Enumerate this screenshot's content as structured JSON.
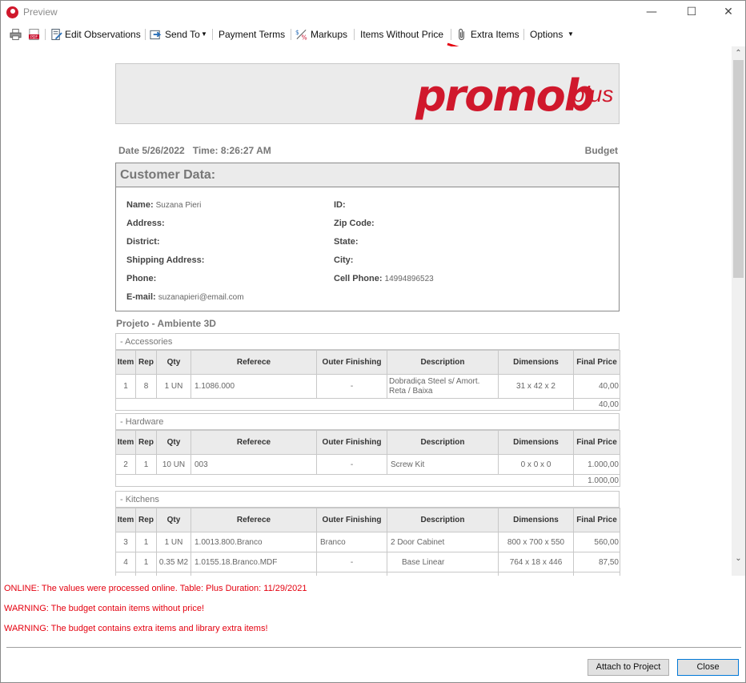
{
  "window": {
    "title": "Preview",
    "minimize": "—",
    "maximize": "☐",
    "close": "✕"
  },
  "toolbar": {
    "print_icon": "printer-icon",
    "pdf_icon": "pdf-icon",
    "edit_observations": "Edit Observations",
    "send_to": "Send To",
    "payment_terms": "Payment Terms",
    "markups": "Markups",
    "items_without_price": "Items Without Price",
    "extra_items": "Extra Items",
    "options": "Options"
  },
  "document": {
    "logo_main": "promob",
    "logo_sub": "plus",
    "date_line": "Date 5/26/2022   Time: 8:26:27 AM",
    "budget": "Budget",
    "customer_title": "Customer Data:",
    "customer": {
      "name_label": "Name:",
      "name_value": "Suzana Pieri",
      "id_label": "ID:",
      "address_label": "Address:",
      "zip_label": "Zip Code:",
      "district_label": "District:",
      "state_label": "State:",
      "shipping_label": "Shipping Address:",
      "city_label": "City:",
      "phone_label": "Phone:",
      "cell_label": "Cell Phone:",
      "cell_value": "14994896523",
      "email_label": "E-mail:",
      "email_value": "suzanapieri@email.com"
    },
    "project_title": "Projeto - Ambiente 3D",
    "columns": [
      "Item",
      "Rep",
      "Qty",
      "Referece",
      "Outer Finishing",
      "Description",
      "Dimensions",
      "Final Price"
    ],
    "sections": [
      {
        "title": "- Accessories",
        "rows": [
          [
            "1",
            "8",
            "1 UN",
            "1.1086.000",
            "-",
            "Dobradiça Steel s/ Amort. Reta / Baixa",
            "31 x 42 x 2",
            "40,00"
          ]
        ],
        "total": "40,00"
      },
      {
        "title": "- Hardware",
        "rows": [
          [
            "2",
            "1",
            "10 UN",
            "003",
            "-",
            "Screw Kit",
            "0 x 0 x 0",
            "1.000,00"
          ]
        ],
        "total": "1.000,00"
      },
      {
        "title": "- Kitchens",
        "rows": [
          [
            "3",
            "1",
            "1 UN",
            "1.0013.800.Branco",
            "Branco",
            "2 Door Cabinet",
            "800 x 700 x 550",
            "560,00"
          ],
          [
            "4",
            "1",
            "0.35 M2",
            "1.0155.18.Branco.MDF",
            "-",
            "Base Linear",
            "764 x 18 x 446",
            "87,50"
          ]
        ]
      }
    ]
  },
  "messages": [
    "ONLINE: The values were processed online. Table: Plus Duration: 11/29/2021",
    "WARNING: The budget contain items without price!",
    "WARNING: The budget contains extra items and library extra items!"
  ],
  "buttons": {
    "attach": "Attach to Project",
    "close": "Close"
  },
  "colors": {
    "accent_red": "#d0182c",
    "warning_red": "#e4000f"
  }
}
